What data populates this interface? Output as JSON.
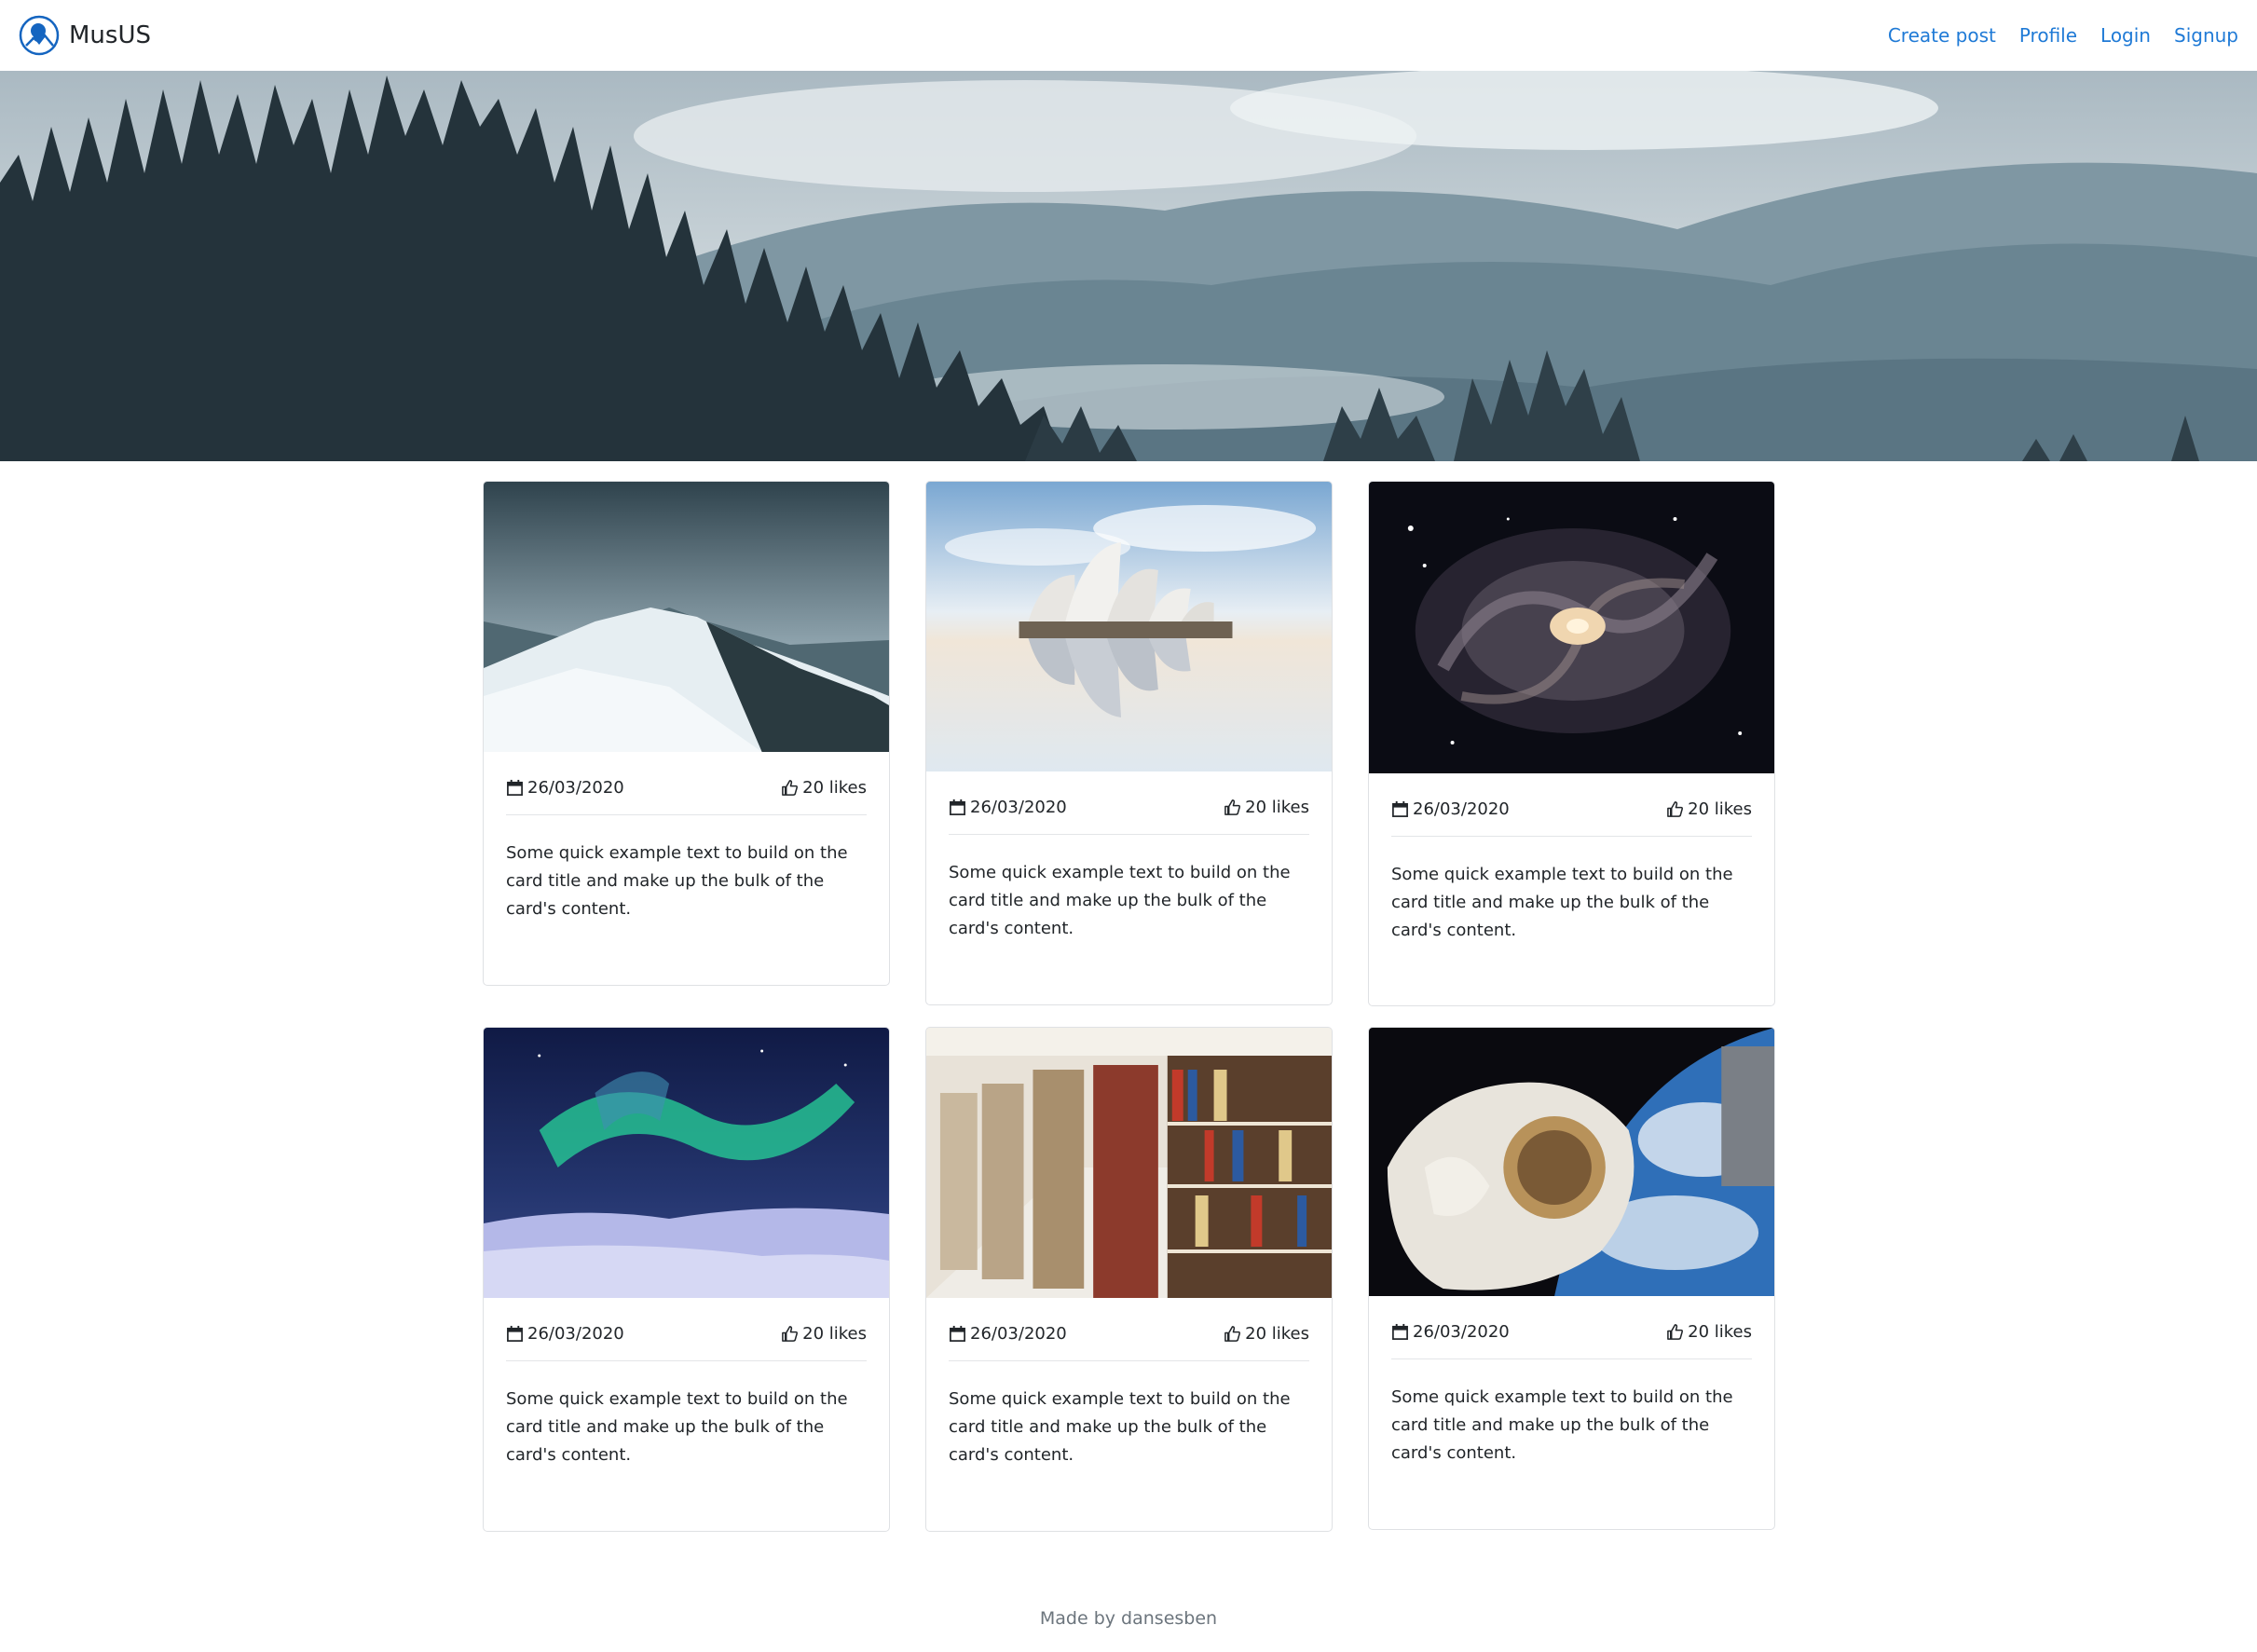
{
  "navbar": {
    "brand": "MusUS",
    "links": [
      "Create post",
      "Profile",
      "Login",
      "Signup"
    ]
  },
  "hero": {
    "image": "forest-mountains-fog"
  },
  "cards": [
    {
      "image": "snowy-mountain",
      "date": "26/03/2020",
      "likes": "20 likes",
      "text": "Some quick example text to build on the card title and make up the bulk of the card's content."
    },
    {
      "image": "sydney-opera-house",
      "date": "26/03/2020",
      "likes": "20 likes",
      "text": "Some quick example text to build on the card title and make up the bulk of the card's content."
    },
    {
      "image": "spiral-galaxy",
      "date": "26/03/2020",
      "likes": "20 likes",
      "text": "Some quick example text to build on the card title and make up the bulk of the card's content."
    },
    {
      "image": "northern-lights",
      "date": "26/03/2020",
      "likes": "20 likes",
      "text": "Some quick example text to build on the card title and make up the bulk of the card's content."
    },
    {
      "image": "library-bookshelves",
      "date": "26/03/2020",
      "likes": "20 likes",
      "text": "Some quick example text to build on the card title and make up the bulk of the card's content."
    },
    {
      "image": "astronaut-space",
      "date": "26/03/2020",
      "likes": "20 likes",
      "text": "Some quick example text to build on the card title and make up the bulk of the card's content."
    }
  ],
  "footer": {
    "text": "Made by dansesben"
  },
  "colors": {
    "link": "#1f7ad6",
    "brand_logo": "#1565c0",
    "border": "#dfe1e4"
  }
}
